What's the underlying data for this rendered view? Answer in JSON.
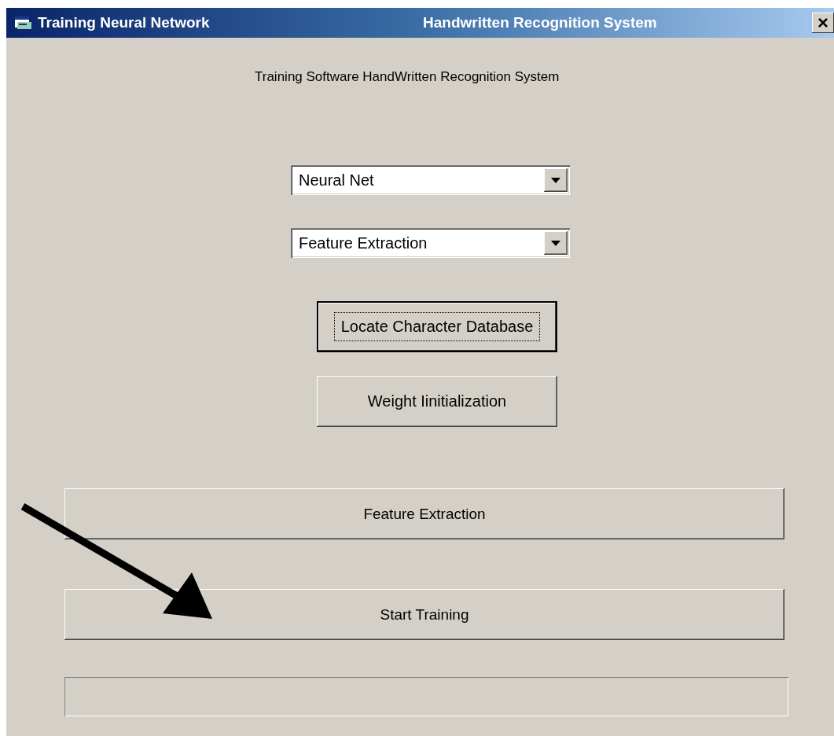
{
  "window": {
    "title": "Training Neural Network",
    "subtitle": "Handwritten Recognition System",
    "close": "×"
  },
  "heading": "Training Software HandWritten Recognition System",
  "dropdowns": [
    {
      "value": "Neural Net"
    },
    {
      "value": "Feature Extraction"
    }
  ],
  "buttons": [
    {
      "label": "Locate Character Database",
      "focused": true,
      "kind": "small"
    },
    {
      "label": "Weight Iinitialization",
      "focused": false,
      "kind": "small"
    },
    {
      "label": "Feature Extraction",
      "focused": false,
      "kind": "wide"
    },
    {
      "label": "Start Training",
      "focused": false,
      "kind": "wide"
    }
  ],
  "progress": {
    "level": 0
  }
}
